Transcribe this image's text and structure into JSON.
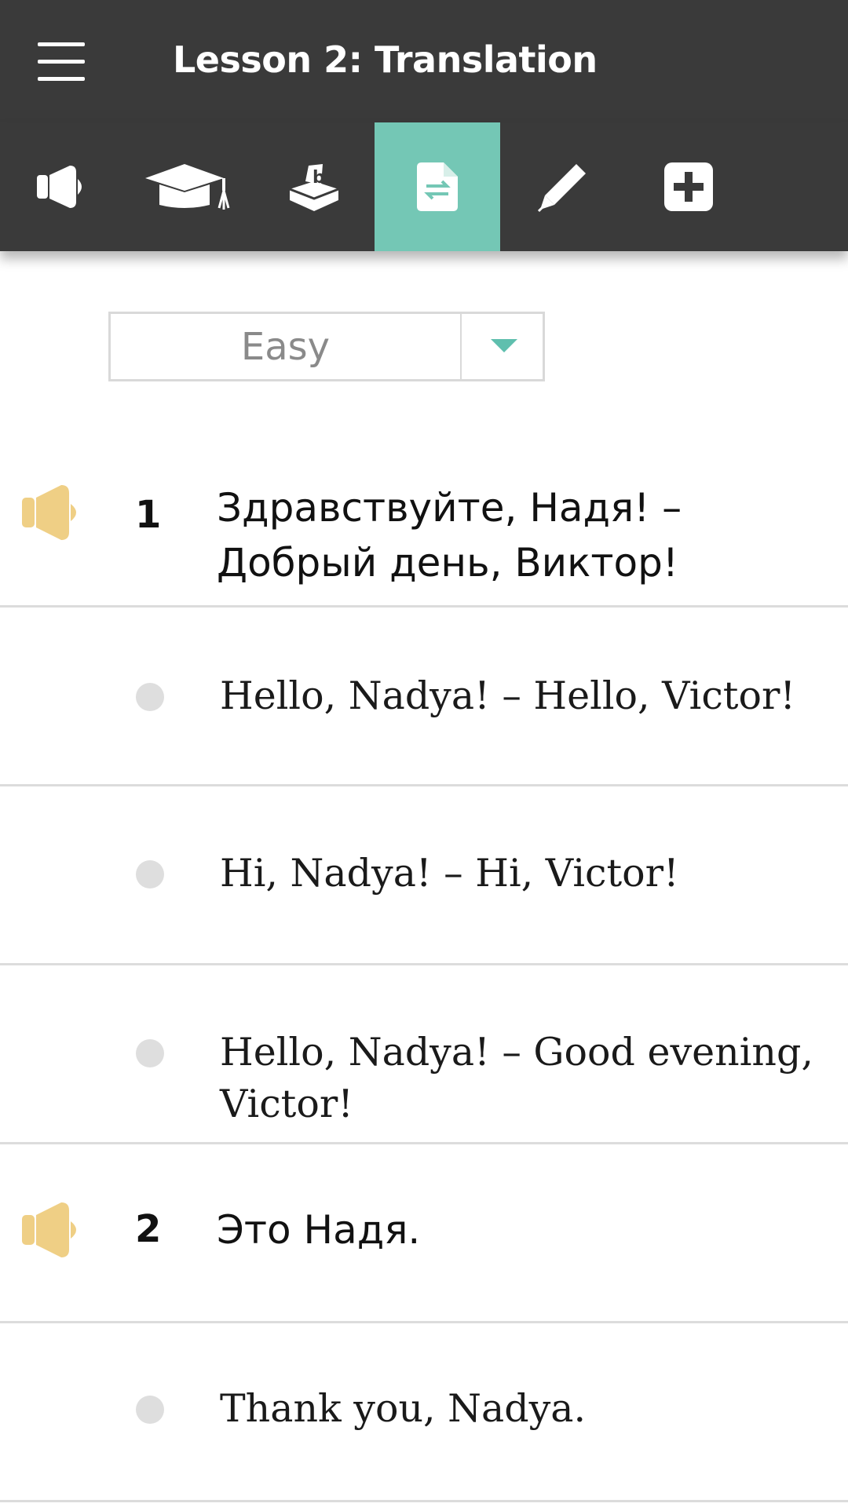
{
  "header": {
    "title": "Lesson 2: Translation"
  },
  "toolbar": {
    "tabs": [
      {
        "icon": "megaphone-icon",
        "active": false
      },
      {
        "icon": "graduation-cap-icon",
        "active": false
      },
      {
        "icon": "letter-box-icon",
        "active": false
      },
      {
        "icon": "translation-document-icon",
        "active": true
      },
      {
        "icon": "pen-icon",
        "active": false
      },
      {
        "icon": "plus-box-icon",
        "active": false
      }
    ],
    "active_color": "#74c7b5"
  },
  "difficulty": {
    "value": "Easy"
  },
  "phrases": [
    {
      "number": "1",
      "text_line1": "Здравствуйте, Надя! –",
      "text_line2": "Добрый день, Виктор!",
      "options": [
        "Hello, Nadya! – Hello, Victor!",
        "Hi, Nadya! – Hi, Victor!"
      ],
      "option3_line1": "Hello, Nadya! – Good evening,",
      "option3_line2": "Victor!"
    },
    {
      "number": "2",
      "text": "Это Надя.",
      "options": [
        "Thank you, Nadya."
      ]
    }
  ],
  "colors": {
    "bar": "#3a3a3a",
    "speaker": "#efcf85",
    "divider": "#dcdcdc"
  }
}
